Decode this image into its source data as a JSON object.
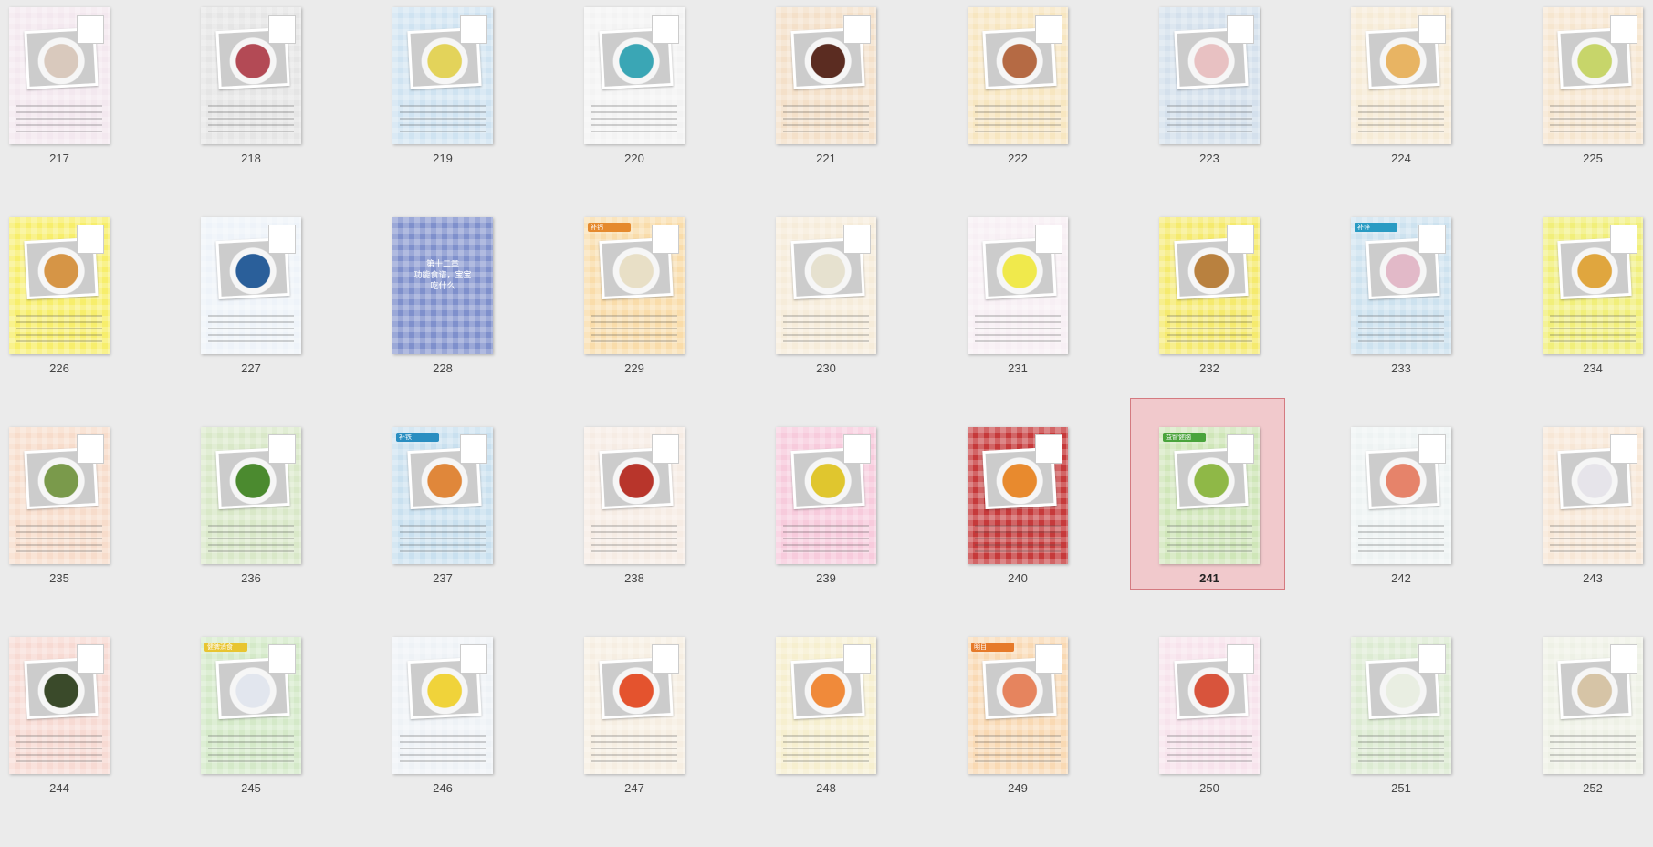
{
  "viewer": {
    "mode": "page-thumbnails",
    "selected_page": "241"
  },
  "pages": [
    {
      "number": "217",
      "bg": "#f3e8ef",
      "accent": "#d9c9bd"
    },
    {
      "number": "218",
      "bg": "#e5e5e5",
      "accent": "#b34a55"
    },
    {
      "number": "219",
      "bg": "#cfe3f1",
      "accent": "#e3d35a"
    },
    {
      "number": "220",
      "bg": "#f3f3f3",
      "accent": "#3aa6b5"
    },
    {
      "number": "221",
      "bg": "#f4e0c9",
      "accent": "#5b2c21"
    },
    {
      "number": "222",
      "bg": "#f7e6c0",
      "accent": "#b56a44"
    },
    {
      "number": "223",
      "bg": "#d4e0ec",
      "accent": "#e8c1c2"
    },
    {
      "number": "224",
      "bg": "#f6ebd6",
      "accent": "#e8b463"
    },
    {
      "number": "225",
      "bg": "#f6e6cf",
      "accent": "#c7d56a"
    },
    {
      "number": "226",
      "bg": "#f7ee6c",
      "accent": "#d69546"
    },
    {
      "number": "227",
      "bg": "#eef3f9",
      "accent": "#2a5f9a"
    },
    {
      "number": "228",
      "bg": "#7f90cc",
      "accent": "#7f90cc",
      "cover_text": "第十二章\n功能食谱，宝宝\n吃什么"
    },
    {
      "number": "229",
      "bg": "#f9dcaa",
      "accent": "#e8dfc6",
      "badge": "#e58a2e",
      "badge_text": "补钙"
    },
    {
      "number": "230",
      "bg": "#f6ecda",
      "accent": "#e6e1cf"
    },
    {
      "number": "231",
      "bg": "#f7eff4",
      "accent": "#f0e94c"
    },
    {
      "number": "232",
      "bg": "#f5ea6e",
      "accent": "#b9813f"
    },
    {
      "number": "233",
      "bg": "#cde2ef",
      "accent": "#e2b9c8",
      "badge": "#2a9bc3",
      "badge_text": "补锌"
    },
    {
      "number": "234",
      "bg": "#f1ef7a",
      "accent": "#e0a63e"
    },
    {
      "number": "235",
      "bg": "#f7dccb",
      "accent": "#7a9a4b"
    },
    {
      "number": "236",
      "bg": "#d9e8c8",
      "accent": "#4b8a2f"
    },
    {
      "number": "237",
      "bg": "#c9e0ef",
      "accent": "#e0873a",
      "badge": "#2a8ec1",
      "badge_text": "补铁"
    },
    {
      "number": "238",
      "bg": "#f6ece4",
      "accent": "#b8352b"
    },
    {
      "number": "239",
      "bg": "#f7cbdc",
      "accent": "#e0c62e"
    },
    {
      "number": "240",
      "bg": "#c63a3b",
      "accent": "#e88a2e"
    },
    {
      "number": "241",
      "bg": "#cfe6b8",
      "accent": "#8fb847",
      "badge": "#4aa43c",
      "badge_text": "益智健脑"
    },
    {
      "number": "242",
      "bg": "#eef3f3",
      "accent": "#e6836a"
    },
    {
      "number": "243",
      "bg": "#f7e7d6",
      "accent": "#e6e4ea"
    },
    {
      "number": "244",
      "bg": "#f7dad3",
      "accent": "#3a4a2a"
    },
    {
      "number": "245",
      "bg": "#d4e9c8",
      "accent": "#e2e6ee",
      "badge": "#e8c531",
      "badge_text": "健脾消食"
    },
    {
      "number": "246",
      "bg": "#eef2f6",
      "accent": "#f0d33a"
    },
    {
      "number": "247",
      "bg": "#f6eee2",
      "accent": "#e4532e"
    },
    {
      "number": "248",
      "bg": "#f6efcf",
      "accent": "#f08a3a"
    },
    {
      "number": "249",
      "bg": "#f9d9b3",
      "accent": "#e6845e",
      "badge": "#e67a2a",
      "badge_text": "明目"
    },
    {
      "number": "250",
      "bg": "#f7e3ec",
      "accent": "#d8543c"
    },
    {
      "number": "251",
      "bg": "#dcebd2",
      "accent": "#e9eee2"
    },
    {
      "number": "252",
      "bg": "#eef1e6",
      "accent": "#d6c4a6"
    }
  ]
}
